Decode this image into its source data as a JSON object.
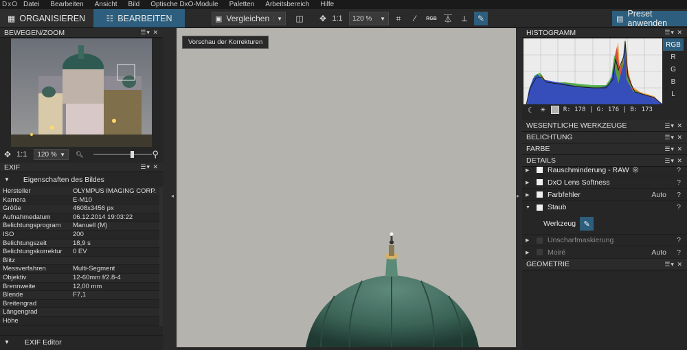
{
  "menubar": {
    "logo": "DxO",
    "items": [
      "Datei",
      "Bearbeiten",
      "Ansicht",
      "Bild",
      "Optische DxO-Module",
      "Paletten",
      "Arbeitsbereich",
      "Hilfe"
    ]
  },
  "toolbar": {
    "organize": "ORGANISIEREN",
    "edit": "BEARBEITEN",
    "compare": "Vergleichen",
    "one_to_one": "1:1",
    "zoom": "120 %",
    "rgb_label": "RGB",
    "preset": "Preset anwenden"
  },
  "left": {
    "nav_title": "BEWEGEN/ZOOM",
    "nav_one_to_one": "1:1",
    "nav_zoom": "120 %",
    "exif_title": "EXIF",
    "exif_section": "Eigenschaften des Bildes",
    "exif_rows": [
      {
        "k": "Hersteller",
        "v": "OLYMPUS IMAGING CORP."
      },
      {
        "k": "Kamera",
        "v": "E-M10"
      },
      {
        "k": "Größe",
        "v": "4608x3456 px"
      },
      {
        "k": "Aufnahmedatum",
        "v": "06.12.2014 19:03:22"
      },
      {
        "k": "Belichtungsprogram",
        "v": "Manuell (M)"
      },
      {
        "k": "ISO",
        "v": "200"
      },
      {
        "k": "Belichtungszeit",
        "v": "18,9 s"
      },
      {
        "k": "Belichtungskorrektur",
        "v": "0 EV"
      },
      {
        "k": "Blitz",
        "v": ""
      },
      {
        "k": "Messverfahren",
        "v": "Multi-Segment"
      },
      {
        "k": "Objektiv",
        "v": "12-60mm f/2.8-4"
      },
      {
        "k": "Brennweite",
        "v": "12,00 mm"
      },
      {
        "k": "Blende",
        "v": "F7,1"
      },
      {
        "k": "Breitengrad",
        "v": ""
      },
      {
        "k": "Längengrad",
        "v": ""
      },
      {
        "k": "Höhe",
        "v": ""
      }
    ],
    "exif_editor": "EXIF Editor"
  },
  "center": {
    "preview_tag": "Vorschau der Korrekturen"
  },
  "right": {
    "hist_title": "HISTOGRAMM",
    "channels": [
      "RGB",
      "R",
      "G",
      "B",
      "L"
    ],
    "readout": "R: 178  |  G: 176  |  B: 173",
    "sections": {
      "essential": "WESENTLICHE WERKZEUGE",
      "exposure": "BELICHTUNG",
      "color": "FARBE",
      "details": "DETAILS",
      "geometry": "GEOMETRIE"
    },
    "detail_items": [
      {
        "label": "Rauschminderung - RAW",
        "right": "",
        "dim": false
      },
      {
        "label": "DxO Lens Softness",
        "right": "",
        "dim": false
      },
      {
        "label": "Farbfehler",
        "right": "Auto",
        "dim": false
      },
      {
        "label": "Staub",
        "right": "",
        "dim": false
      }
    ],
    "tool_label": "Werkzeug",
    "detail_items_after": [
      {
        "label": "Unscharfmaskierung",
        "right": "",
        "dim": true
      },
      {
        "label": "Moiré",
        "right": "Auto",
        "dim": true
      }
    ],
    "question_mark": "?"
  },
  "panel_controls": "☰▾ ✕"
}
